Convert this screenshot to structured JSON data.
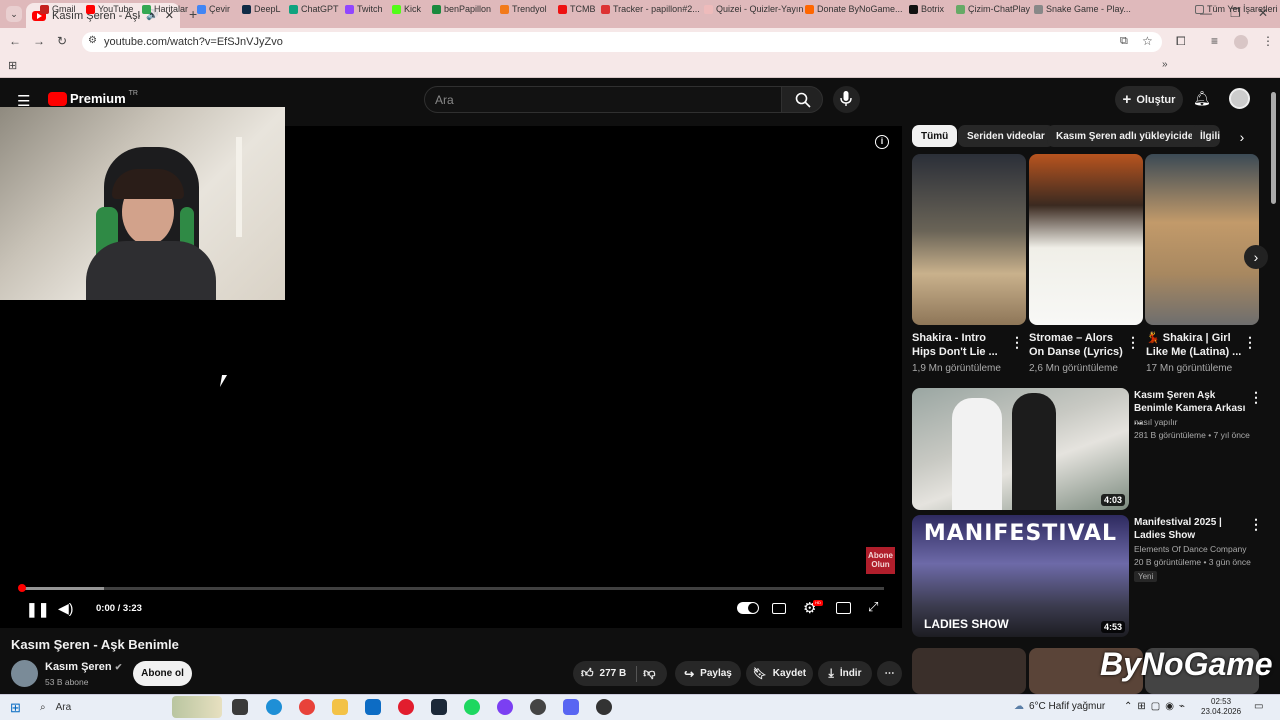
{
  "browser": {
    "tab_title": "Kasım Şeren - Aşk Benimle",
    "url": "youtube.com/watch?v=EfSJnVJyZvo",
    "bookmarks": [
      "Gmail",
      "YouTube",
      "Haritalar",
      "Çevir",
      "DeepL",
      "ChatGPT",
      "Twitch",
      "Kick",
      "benPapillon",
      "Trendyol",
      "TCMB",
      "Tracker - papillon#2...",
      "Quizei - Quizler-Yayın",
      "Donate ByNoGame...",
      "Botrix",
      "Çizim-ChatPlay",
      "Snake Game - Play..."
    ],
    "bookmarks_all": "Tüm Yer İşaretleri"
  },
  "youtube": {
    "logo": "Premium",
    "logo_badge": "TR",
    "search_placeholder": "Ara",
    "create_label": "Oluştur",
    "player": {
      "time": "0:00 / 3:23",
      "progress": 0.0,
      "watermark": "Abone Olun"
    },
    "video": {
      "title": "Kasım Şeren - Aşk Benimle",
      "channel": "Kasım Şeren",
      "subscribers": "53 B abone",
      "subscribe_label": "Abone ol",
      "likes": "277 B",
      "share_label": "Paylaş",
      "save_label": "Kaydet",
      "download_label": "İndir"
    },
    "chips": [
      "Tümü",
      "Seriden videolar",
      "Kasım Şeren adlı yükleyiciden",
      "İlgili"
    ],
    "shorts": [
      {
        "title": "Shakira - Intro Hips Don't Lie ...",
        "views": "1,9 Mn görüntüleme"
      },
      {
        "title": "Stromae – Alors On Danse (Lyrics)",
        "views": "2,6 Mn görüntüleme"
      },
      {
        "title": "💃 Shakira | Girl Like Me (Latina) ...",
        "views": "17 Mn görüntüleme"
      }
    ],
    "recommended": [
      {
        "title": "Kasım Şeren  Aşk Benimle Kamera Arkası ...",
        "channel": "nasıl yapılır",
        "meta": "281 B görüntüleme • 7 yıl önce",
        "duration": "4:03",
        "badge": ""
      },
      {
        "title": "Manifestival 2025 | Ladies Show",
        "channel": "Elements Of Dance Company",
        "meta": "20 B görüntüleme • 3 gün önce",
        "duration": "4:53",
        "badge": "Yeni",
        "thumb_text": "MANIFESTIVAL",
        "thumb_sub": "LADIES SHOW"
      }
    ],
    "overlay_logo": "ByNoGame"
  },
  "taskbar": {
    "search": "Ara",
    "weather": "6°C  Hafif yağmur",
    "time": "02:53",
    "date": "23.04.2026"
  }
}
